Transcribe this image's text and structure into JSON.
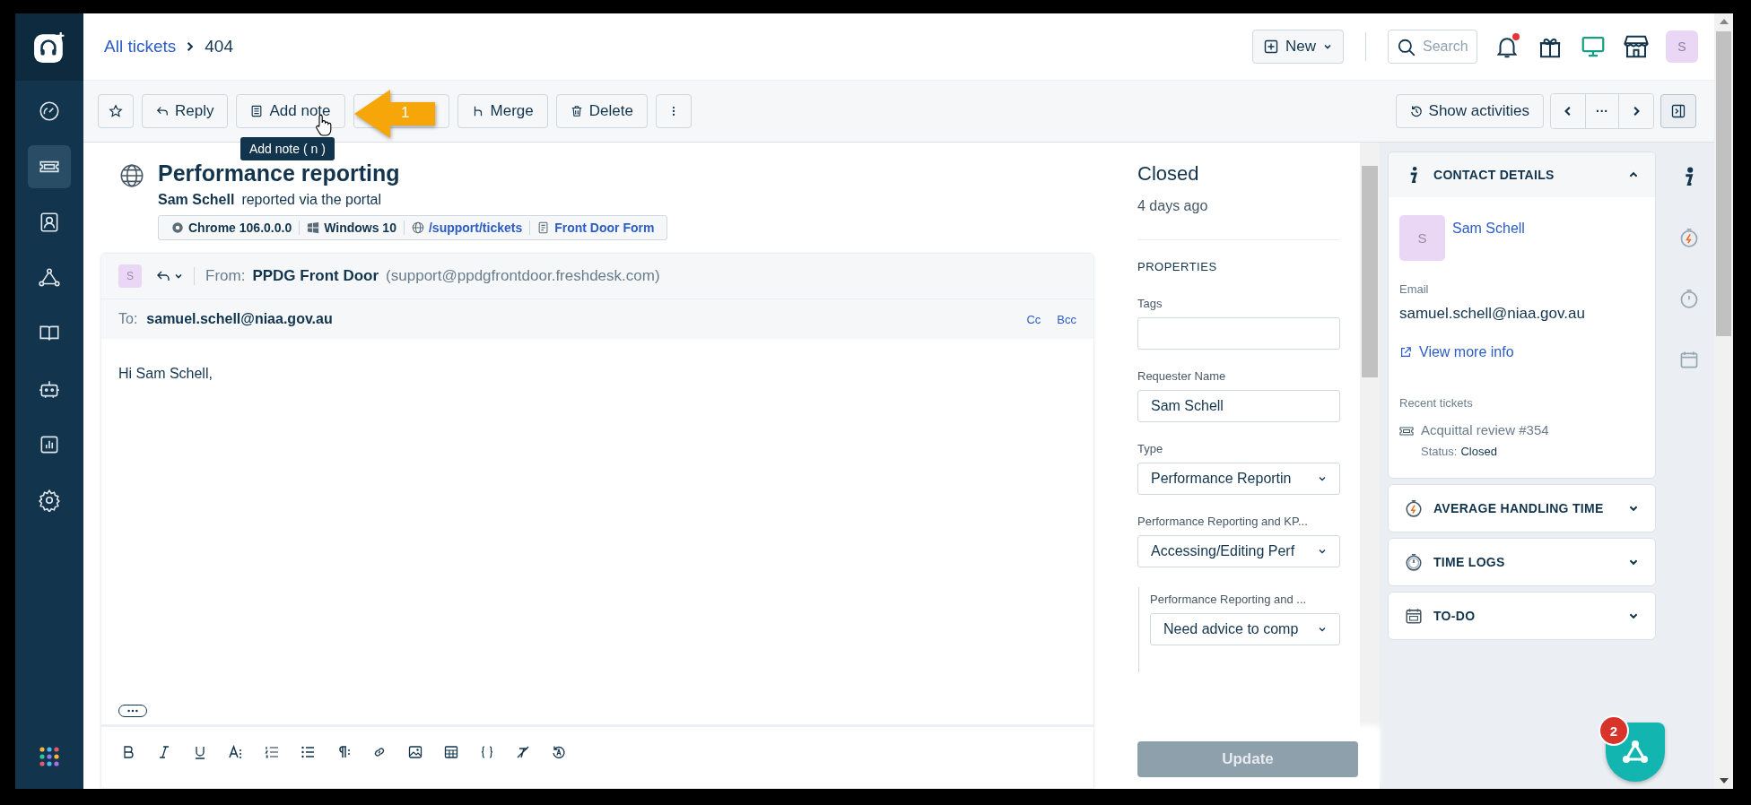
{
  "sidebar": {
    "items": [
      {
        "kind": "dashboard",
        "selected": false
      },
      {
        "kind": "tickets",
        "selected": true
      },
      {
        "kind": "contacts",
        "selected": false
      },
      {
        "kind": "network",
        "selected": false
      },
      {
        "kind": "book",
        "selected": false
      },
      {
        "kind": "bot",
        "selected": false
      },
      {
        "kind": "reports",
        "selected": false
      },
      {
        "kind": "settings",
        "selected": false
      }
    ]
  },
  "breadcrumb": {
    "link": "All tickets",
    "current": "404"
  },
  "header": {
    "new_button": "New",
    "search_placeholder": "Search",
    "notification_unread": true,
    "avatar": "S"
  },
  "toolbar": {
    "buttons": [
      {
        "kind": "star"
      },
      {
        "kind": "reply",
        "label": "Reply"
      },
      {
        "kind": "note",
        "label": "Add note"
      },
      {
        "kind": "hidden"
      },
      {
        "kind": "merge",
        "label": "Merge"
      },
      {
        "kind": "delete",
        "label": "Delete"
      },
      {
        "kind": "more"
      }
    ],
    "activities_button": "Show activities",
    "pager_more": "···"
  },
  "tooltip": "Add note ( n )",
  "annotation": {
    "number": "1"
  },
  "ticket": {
    "title": "Performance reporting",
    "reporter": "Sam Schell",
    "source": "reported via the portal",
    "meta": [
      {
        "kind": "browser",
        "text": "Chrome 106.0.0.0",
        "link": false
      },
      {
        "kind": "os",
        "text": "Windows 10",
        "link": false
      },
      {
        "kind": "url",
        "text": "/support/tickets",
        "link": true
      },
      {
        "kind": "form",
        "text": "Front Door Form",
        "link": true
      }
    ]
  },
  "reply": {
    "avatar": "S",
    "from_label": "From:",
    "from_name": "PPDG Front Door",
    "from_email": "(support@ppdgfrontdoor.freshdesk.com)",
    "to_label": "To:",
    "to": "samuel.schell@niaa.gov.au",
    "cc": "Cc",
    "bcc": "Bcc",
    "body": "Hi Sam Schell,",
    "editor_tools": [
      {
        "kind": "bold"
      },
      {
        "kind": "italic"
      },
      {
        "kind": "underline"
      },
      {
        "kind": "fontsize"
      },
      {
        "kind": "ordered"
      },
      {
        "kind": "bullets"
      },
      {
        "kind": "paragraph"
      },
      {
        "kind": "link"
      },
      {
        "kind": "image"
      },
      {
        "kind": "table"
      },
      {
        "kind": "code"
      },
      {
        "kind": "clear"
      },
      {
        "kind": "autocorrect"
      }
    ]
  },
  "status": {
    "label": "Closed",
    "time": "4 days ago"
  },
  "properties": {
    "heading": "PROPERTIES",
    "fields": [
      {
        "kind": "text",
        "label": "Tags"
      },
      {
        "kind": "text",
        "label": "Requester Name",
        "value": "Sam Schell"
      },
      {
        "kind": "select",
        "label": "Type",
        "value": "Performance Reportin"
      },
      {
        "kind": "select",
        "label": "Performance Reporting and KP...",
        "value": "Accessing/Editing Perf",
        "children": [
          {
            "kind": "select",
            "label": "Performance Reporting and ...",
            "value": "Need advice to comp"
          }
        ]
      }
    ],
    "update_button": {
      "label": "Update",
      "disabled": true
    }
  },
  "contact": {
    "header": "CONTACT DETAILS",
    "expanded": true,
    "avatar": "S",
    "name": "Sam Schell",
    "email_label": "Email",
    "email": "samuel.schell@niaa.gov.au",
    "view_more": "View more info",
    "recent_label": "Recent tickets",
    "recent_tickets": [
      {
        "title": "Acquittal review #354",
        "status_label": "Status:",
        "status": "Closed"
      }
    ]
  },
  "sections": [
    {
      "kind": "handling",
      "title": "AVERAGE HANDLING TIME",
      "expanded": false
    },
    {
      "kind": "timer",
      "title": "TIME LOGS",
      "expanded": false
    },
    {
      "kind": "calendar",
      "title": "TO-DO",
      "expanded": false
    }
  ],
  "rail": [
    {
      "kind": "info",
      "selected": true
    },
    {
      "kind": "handling",
      "selected": false
    },
    {
      "kind": "timer",
      "selected": false
    },
    {
      "kind": "calendar",
      "selected": false
    }
  ],
  "fab": {
    "badge": "2"
  }
}
